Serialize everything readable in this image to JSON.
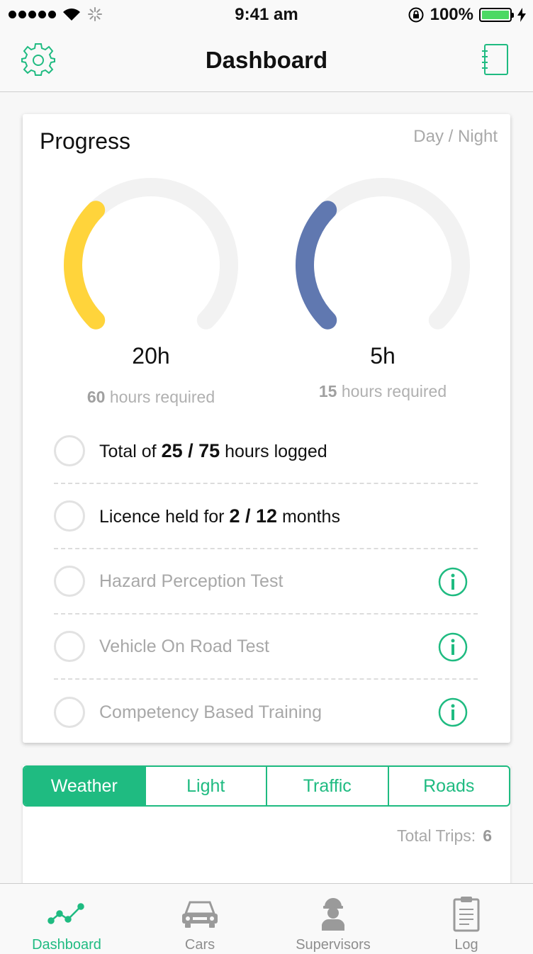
{
  "status_bar": {
    "time": "9:41 am",
    "battery_percent": "100%"
  },
  "nav": {
    "title": "Dashboard",
    "left_icon": "gear-icon",
    "right_icon": "notebook-icon"
  },
  "progress": {
    "title": "Progress",
    "toggle_label": "Day / Night",
    "day": {
      "value_label": "20h",
      "required_hours": "60",
      "required_suffix": "hours required",
      "logged_hours": 20,
      "required_total": 60,
      "color": "#ffd43b"
    },
    "night": {
      "value_label": "5h",
      "required_hours": "15",
      "required_suffix": "hours required",
      "logged_hours": 5,
      "required_total": 15,
      "color": "#6078b0"
    },
    "checklist": {
      "total_logged": {
        "prefix": "Total of ",
        "value": "25 / 75",
        "suffix": " hours logged"
      },
      "licence_held": {
        "prefix": "Licence held for ",
        "value": "2 / 12",
        "suffix": " months"
      },
      "hazard_test": "Hazard Perception Test",
      "vehicle_test": "Vehicle On Road Test",
      "competency_training": "Competency Based Training"
    }
  },
  "segments": {
    "items": [
      "Weather",
      "Light",
      "Traffic",
      "Roads"
    ],
    "active": "Weather"
  },
  "trips": {
    "label": "Total Trips:",
    "value": "6"
  },
  "tab_bar": {
    "items": [
      "Dashboard",
      "Cars",
      "Supervisors",
      "Log"
    ],
    "active": "Dashboard"
  },
  "colors": {
    "accent": "#1fbb81",
    "day_gauge": "#ffd43b",
    "night_gauge": "#6078b0",
    "gauge_track": "#f2f2f2"
  }
}
